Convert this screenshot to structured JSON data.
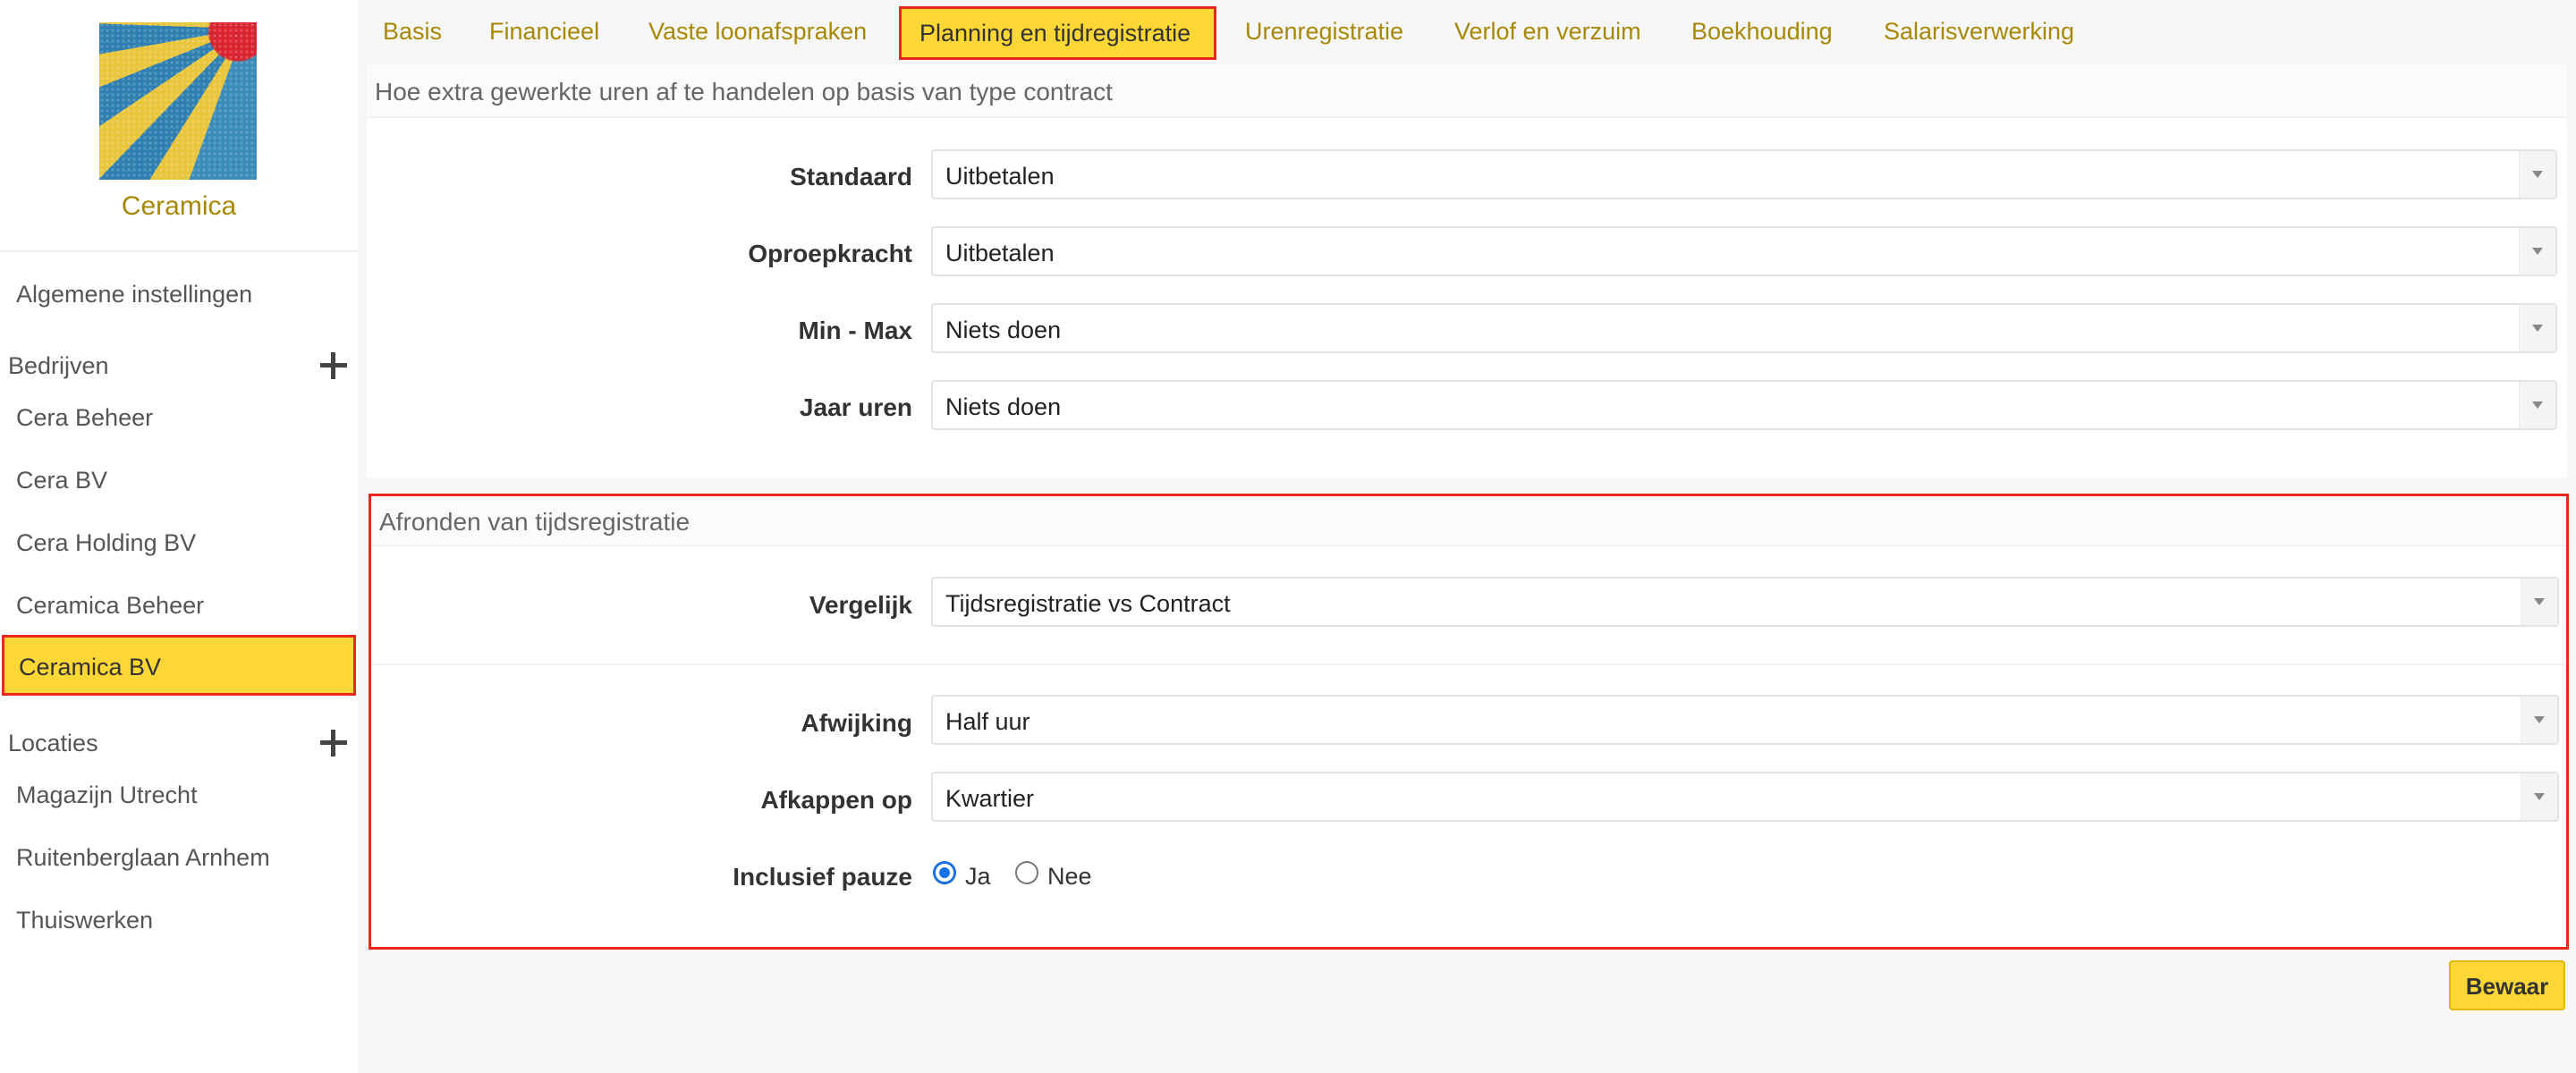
{
  "company": {
    "name": "Ceramica"
  },
  "sidebar": {
    "general": "Algemene instellingen",
    "companies_header": "Bedrijven",
    "companies": [
      "Cera Beheer",
      "Cera BV",
      "Cera Holding BV",
      "Ceramica Beheer",
      "Ceramica BV"
    ],
    "active_company": "Ceramica BV",
    "locations_header": "Locaties",
    "locations": [
      "Magazijn Utrecht",
      "Ruitenberglaan Arnhem",
      "Thuiswerken"
    ]
  },
  "tabs": [
    "Basis",
    "Financieel",
    "Vaste loonafspraken",
    "Planning en tijdregistratie",
    "Urenregistratie",
    "Verlof en verzuim",
    "Boekhouding",
    "Salarisverwerking"
  ],
  "active_tab": "Planning en tijdregistratie",
  "overtime": {
    "title": "Hoe extra gewerkte uren af te handelen op basis van type contract",
    "rows": [
      {
        "label": "Standaard",
        "value": "Uitbetalen"
      },
      {
        "label": "Oproepkracht",
        "value": "Uitbetalen"
      },
      {
        "label": "Min - Max",
        "value": "Niets doen"
      },
      {
        "label": "Jaar uren",
        "value": "Niets doen"
      }
    ]
  },
  "rounding": {
    "title": "Afronden van tijdsregistratie",
    "compare": {
      "label": "Vergelijk",
      "value": "Tijdsregistratie vs Contract"
    },
    "deviation": {
      "label": "Afwijking",
      "value": "Half uur"
    },
    "cutoff": {
      "label": "Afkappen op",
      "value": "Kwartier"
    },
    "include_break": {
      "label": "Inclusief pauze",
      "options": [
        "Ja",
        "Nee"
      ],
      "selected": "Ja"
    }
  },
  "save_label": "Bewaar",
  "colors": {
    "accent": "#fdd735",
    "highlight": "#e8281e",
    "link": "#a78806"
  }
}
